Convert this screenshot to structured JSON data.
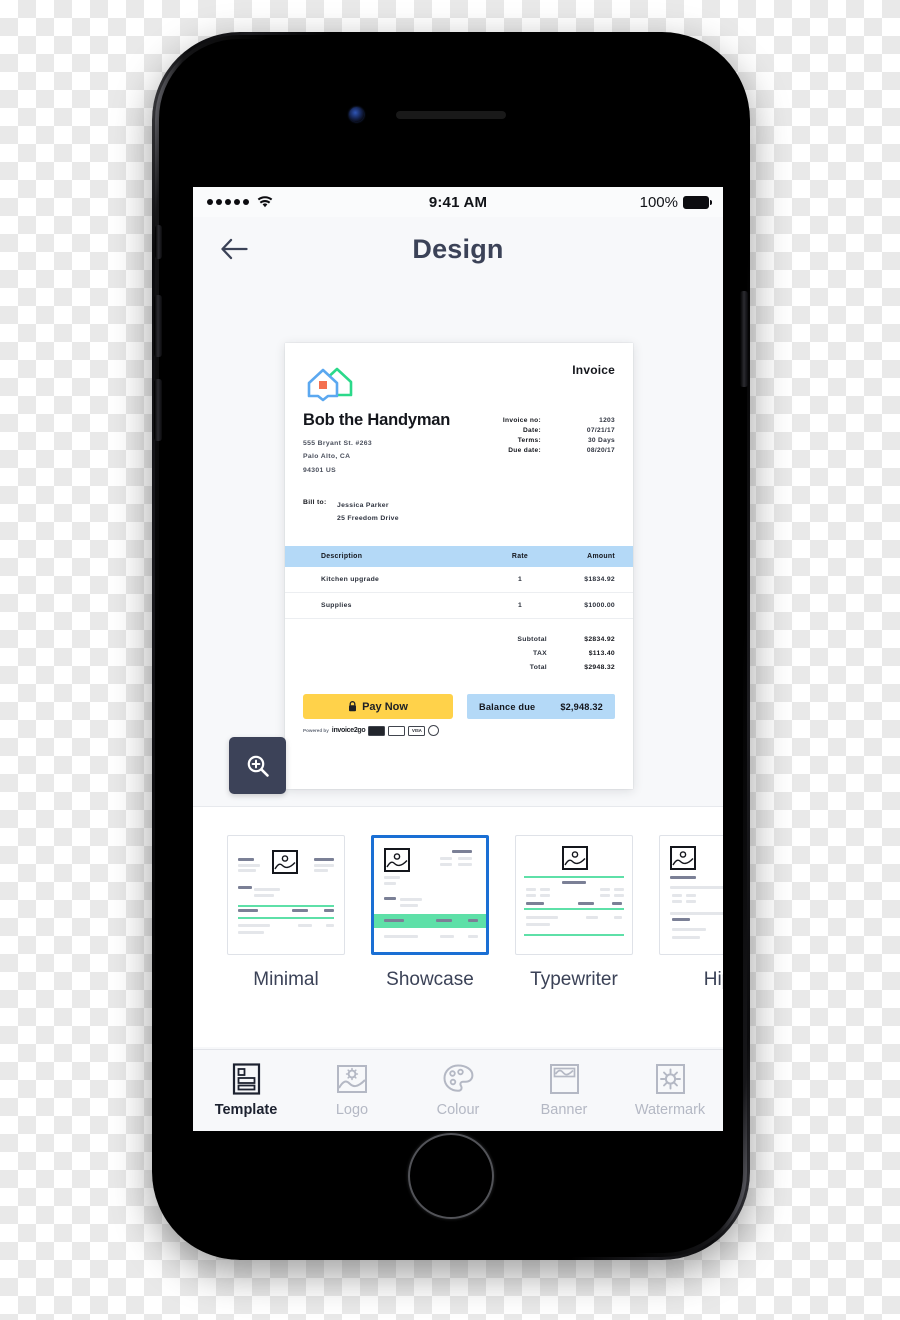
{
  "status_bar": {
    "signal_dots": 5,
    "wifi_icon": "wifi-icon",
    "time": "9:41 AM",
    "battery_percent": "100%"
  },
  "nav": {
    "back_icon": "back-arrow-icon",
    "title": "Design"
  },
  "preview": {
    "zoom_button_icon": "magnify-plus-icon"
  },
  "invoice": {
    "logo_icon": "house-logo-icon",
    "heading": "Invoice",
    "company": "Bob the Handyman",
    "address": [
      "555 Bryant St. #263",
      "Palo Alto, CA",
      "94301 US"
    ],
    "meta": [
      {
        "key": "Invoice no:",
        "value": "1203"
      },
      {
        "key": "Date:",
        "value": "07/21/17"
      },
      {
        "key": "Terms:",
        "value": "30 Days"
      },
      {
        "key": "Due date:",
        "value": "08/20/17"
      }
    ],
    "bill_to_label": "Bill to:",
    "bill_to": [
      "Jessica Parker",
      "25 Freedom Drive"
    ],
    "table": {
      "columns": [
        "Description",
        "Rate",
        "Amount"
      ],
      "rows": [
        {
          "description": "Kitchen upgrade",
          "rate": "1",
          "amount": "$1834.92"
        },
        {
          "description": "Supplies",
          "rate": "1",
          "amount": "$1000.00"
        }
      ]
    },
    "totals": [
      {
        "key": "Subtotal",
        "value": "$2834.92"
      },
      {
        "key": "TAX",
        "value": "$113.40"
      },
      {
        "key": "Total",
        "value": "$2948.32"
      }
    ],
    "pay_now_label": "Pay Now",
    "pay_now_icon": "lock-icon",
    "balance_due_label": "Balance due",
    "balance_due_amount": "$2,948.32",
    "powered_by_text": "Powered by",
    "powered_by_brand": "invoice2go",
    "card_brands": [
      "amex",
      "discover",
      "VISA",
      "mastercard"
    ],
    "colors": {
      "table_header": "#b4d9f7",
      "pay_now": "#ffd24a",
      "logo_blue": "#5ba8f0",
      "logo_green": "#2bd98a",
      "logo_orange": "#f4704f"
    }
  },
  "templates": {
    "items": [
      {
        "label": "Minimal",
        "selected": false,
        "accent": "#5ee0a8"
      },
      {
        "label": "Showcase",
        "selected": true,
        "accent": "#5ee0a8"
      },
      {
        "label": "Typewriter",
        "selected": false,
        "accent": "#5ee0a8"
      },
      {
        "label": "Hip",
        "selected": false,
        "accent": "#e4e6ea"
      }
    ],
    "selected_border_color": "#1a6fd4"
  },
  "tab_bar": {
    "items": [
      {
        "label": "Template",
        "icon": "template-icon",
        "active": true
      },
      {
        "label": "Logo",
        "icon": "image-logo-icon",
        "active": false
      },
      {
        "label": "Colour",
        "icon": "palette-icon",
        "active": false
      },
      {
        "label": "Banner",
        "icon": "banner-icon",
        "active": false
      },
      {
        "label": "Watermark",
        "icon": "watermark-sun-icon",
        "active": false
      }
    ]
  }
}
